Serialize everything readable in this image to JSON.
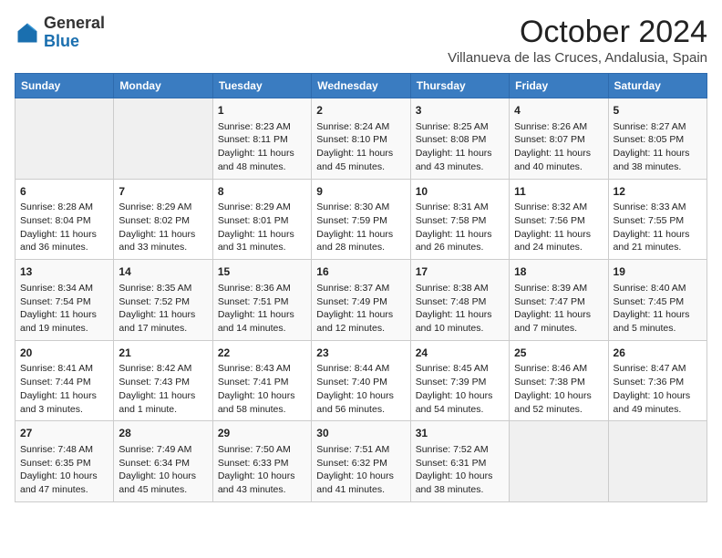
{
  "header": {
    "logo_general": "General",
    "logo_blue": "Blue",
    "month": "October 2024",
    "location": "Villanueva de las Cruces, Andalusia, Spain"
  },
  "days_of_week": [
    "Sunday",
    "Monday",
    "Tuesday",
    "Wednesday",
    "Thursday",
    "Friday",
    "Saturday"
  ],
  "weeks": [
    [
      {
        "day": "",
        "info": ""
      },
      {
        "day": "",
        "info": ""
      },
      {
        "day": "1",
        "info": "Sunrise: 8:23 AM\nSunset: 8:11 PM\nDaylight: 11 hours and 48 minutes."
      },
      {
        "day": "2",
        "info": "Sunrise: 8:24 AM\nSunset: 8:10 PM\nDaylight: 11 hours and 45 minutes."
      },
      {
        "day": "3",
        "info": "Sunrise: 8:25 AM\nSunset: 8:08 PM\nDaylight: 11 hours and 43 minutes."
      },
      {
        "day": "4",
        "info": "Sunrise: 8:26 AM\nSunset: 8:07 PM\nDaylight: 11 hours and 40 minutes."
      },
      {
        "day": "5",
        "info": "Sunrise: 8:27 AM\nSunset: 8:05 PM\nDaylight: 11 hours and 38 minutes."
      }
    ],
    [
      {
        "day": "6",
        "info": "Sunrise: 8:28 AM\nSunset: 8:04 PM\nDaylight: 11 hours and 36 minutes."
      },
      {
        "day": "7",
        "info": "Sunrise: 8:29 AM\nSunset: 8:02 PM\nDaylight: 11 hours and 33 minutes."
      },
      {
        "day": "8",
        "info": "Sunrise: 8:29 AM\nSunset: 8:01 PM\nDaylight: 11 hours and 31 minutes."
      },
      {
        "day": "9",
        "info": "Sunrise: 8:30 AM\nSunset: 7:59 PM\nDaylight: 11 hours and 28 minutes."
      },
      {
        "day": "10",
        "info": "Sunrise: 8:31 AM\nSunset: 7:58 PM\nDaylight: 11 hours and 26 minutes."
      },
      {
        "day": "11",
        "info": "Sunrise: 8:32 AM\nSunset: 7:56 PM\nDaylight: 11 hours and 24 minutes."
      },
      {
        "day": "12",
        "info": "Sunrise: 8:33 AM\nSunset: 7:55 PM\nDaylight: 11 hours and 21 minutes."
      }
    ],
    [
      {
        "day": "13",
        "info": "Sunrise: 8:34 AM\nSunset: 7:54 PM\nDaylight: 11 hours and 19 minutes."
      },
      {
        "day": "14",
        "info": "Sunrise: 8:35 AM\nSunset: 7:52 PM\nDaylight: 11 hours and 17 minutes."
      },
      {
        "day": "15",
        "info": "Sunrise: 8:36 AM\nSunset: 7:51 PM\nDaylight: 11 hours and 14 minutes."
      },
      {
        "day": "16",
        "info": "Sunrise: 8:37 AM\nSunset: 7:49 PM\nDaylight: 11 hours and 12 minutes."
      },
      {
        "day": "17",
        "info": "Sunrise: 8:38 AM\nSunset: 7:48 PM\nDaylight: 11 hours and 10 minutes."
      },
      {
        "day": "18",
        "info": "Sunrise: 8:39 AM\nSunset: 7:47 PM\nDaylight: 11 hours and 7 minutes."
      },
      {
        "day": "19",
        "info": "Sunrise: 8:40 AM\nSunset: 7:45 PM\nDaylight: 11 hours and 5 minutes."
      }
    ],
    [
      {
        "day": "20",
        "info": "Sunrise: 8:41 AM\nSunset: 7:44 PM\nDaylight: 11 hours and 3 minutes."
      },
      {
        "day": "21",
        "info": "Sunrise: 8:42 AM\nSunset: 7:43 PM\nDaylight: 11 hours and 1 minute."
      },
      {
        "day": "22",
        "info": "Sunrise: 8:43 AM\nSunset: 7:41 PM\nDaylight: 10 hours and 58 minutes."
      },
      {
        "day": "23",
        "info": "Sunrise: 8:44 AM\nSunset: 7:40 PM\nDaylight: 10 hours and 56 minutes."
      },
      {
        "day": "24",
        "info": "Sunrise: 8:45 AM\nSunset: 7:39 PM\nDaylight: 10 hours and 54 minutes."
      },
      {
        "day": "25",
        "info": "Sunrise: 8:46 AM\nSunset: 7:38 PM\nDaylight: 10 hours and 52 minutes."
      },
      {
        "day": "26",
        "info": "Sunrise: 8:47 AM\nSunset: 7:36 PM\nDaylight: 10 hours and 49 minutes."
      }
    ],
    [
      {
        "day": "27",
        "info": "Sunrise: 7:48 AM\nSunset: 6:35 PM\nDaylight: 10 hours and 47 minutes."
      },
      {
        "day": "28",
        "info": "Sunrise: 7:49 AM\nSunset: 6:34 PM\nDaylight: 10 hours and 45 minutes."
      },
      {
        "day": "29",
        "info": "Sunrise: 7:50 AM\nSunset: 6:33 PM\nDaylight: 10 hours and 43 minutes."
      },
      {
        "day": "30",
        "info": "Sunrise: 7:51 AM\nSunset: 6:32 PM\nDaylight: 10 hours and 41 minutes."
      },
      {
        "day": "31",
        "info": "Sunrise: 7:52 AM\nSunset: 6:31 PM\nDaylight: 10 hours and 38 minutes."
      },
      {
        "day": "",
        "info": ""
      },
      {
        "day": "",
        "info": ""
      }
    ]
  ]
}
